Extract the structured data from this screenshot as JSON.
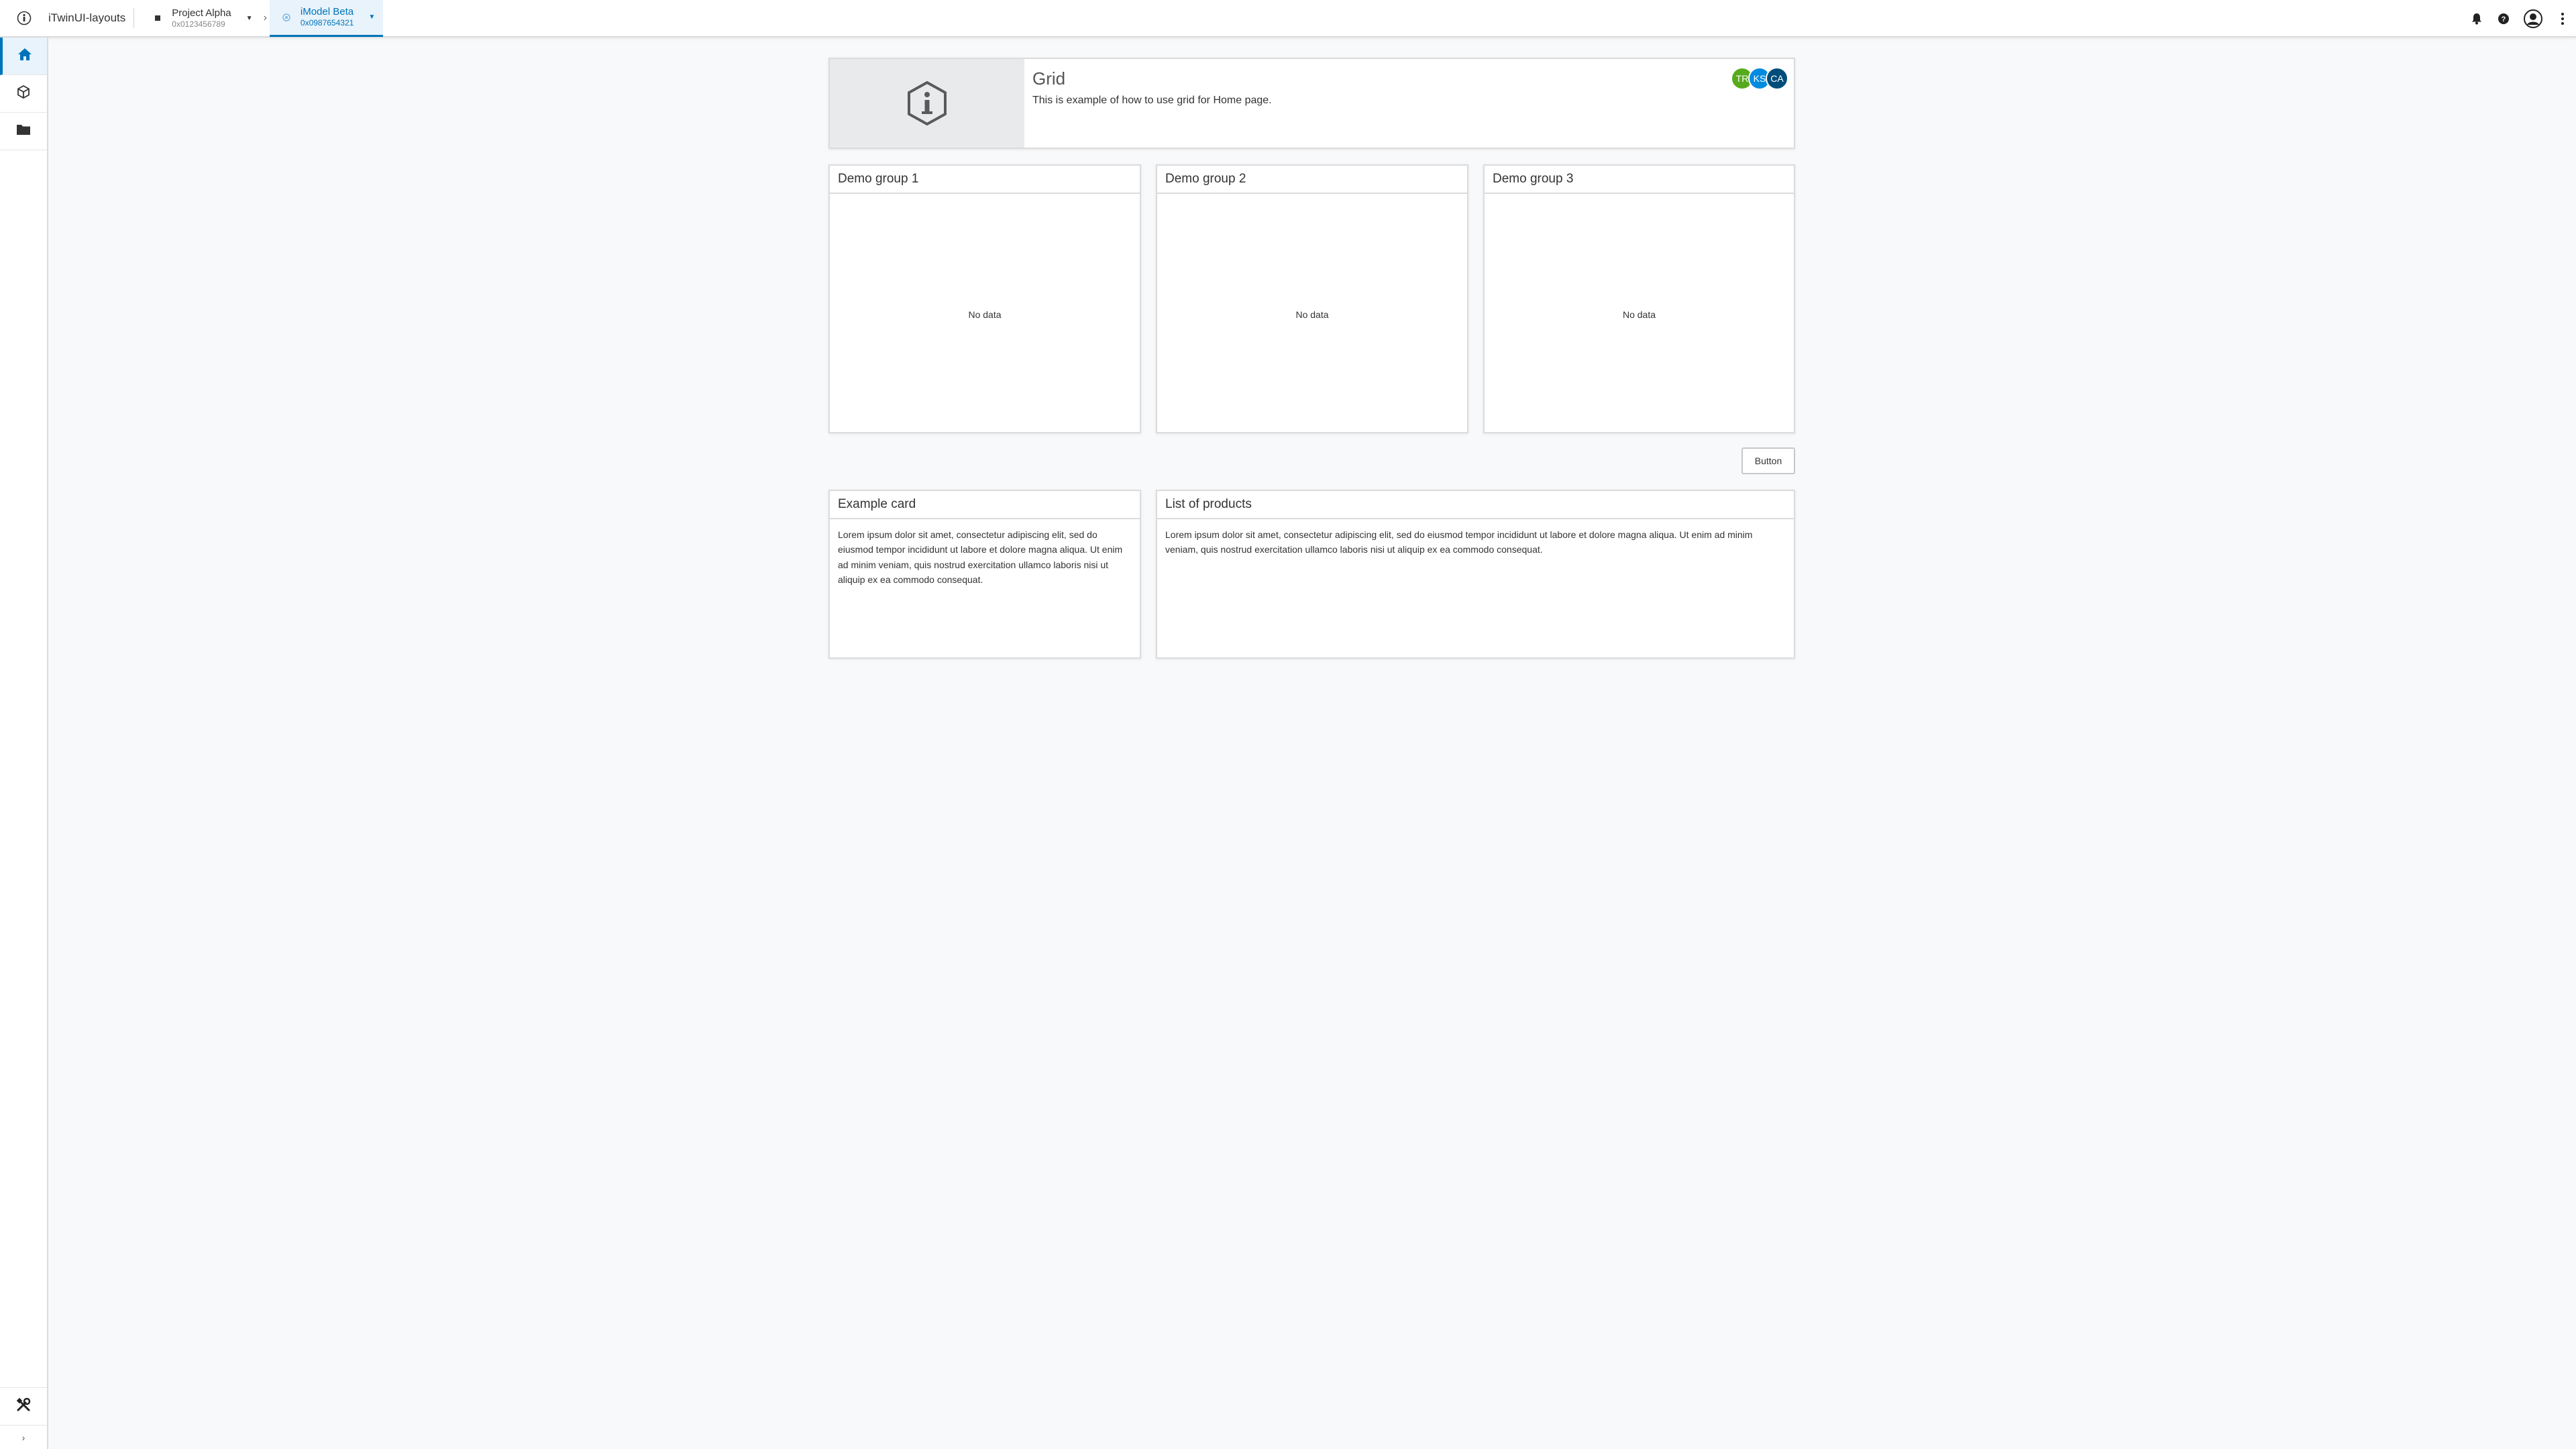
{
  "header": {
    "app_title": "iTwinUI-layouts",
    "project": {
      "name": "Project Alpha",
      "id": "0x0123456789"
    },
    "imodel": {
      "name": "iModel Beta",
      "id": "0x0987654321"
    },
    "icons": [
      "bentley-logo-icon",
      "bell-icon",
      "help-icon",
      "user-avatar-icon",
      "more-vertical-icon"
    ]
  },
  "sidebar": {
    "items": [
      {
        "name": "home",
        "icon": "home-icon",
        "active": true
      },
      {
        "name": "model",
        "icon": "cube-icon",
        "active": false
      },
      {
        "name": "folder",
        "icon": "folder-icon",
        "active": false
      }
    ],
    "bottom": {
      "icon": "tools-icon",
      "expand": "›"
    }
  },
  "tile": {
    "title": "Grid",
    "description": "This is example of how to use grid for Home page.",
    "avatars": [
      {
        "initials": "TR",
        "color": "#56aa1c"
      },
      {
        "initials": "KS",
        "color": "#008be1"
      },
      {
        "initials": "CA",
        "color": "#004d7a"
      }
    ]
  },
  "groups": [
    {
      "title": "Demo group 1",
      "empty": "No data"
    },
    {
      "title": "Demo group 2",
      "empty": "No data"
    },
    {
      "title": "Demo group 3",
      "empty": "No data"
    }
  ],
  "button_label": "Button",
  "example_card": {
    "title": "Example card",
    "text": "Lorem ipsum dolor sit amet, consectetur adipiscing elit, sed do eiusmod tempor incididunt ut labore et dolore magna aliqua. Ut enim ad minim veniam, quis nostrud exercitation ullamco laboris nisi ut aliquip ex ea commodo consequat."
  },
  "products_card": {
    "title": "List of products",
    "text": "Lorem ipsum dolor sit amet, consectetur adipiscing elit, sed do eiusmod tempor incididunt ut labore et dolore magna aliqua. Ut enim ad minim veniam, quis nostrud exercitation ullamco laboris nisi ut aliquip ex ea commodo consequat."
  },
  "colors": {
    "accent": "#0073ba",
    "active_bg": "#e8f3fb"
  }
}
